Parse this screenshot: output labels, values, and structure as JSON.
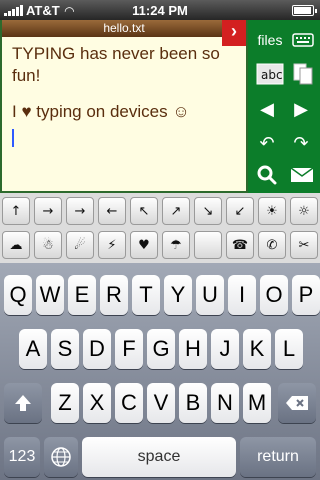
{
  "status_bar": {
    "carrier": "AT&T",
    "time": "11:24 PM"
  },
  "editor": {
    "filename": "hello.txt",
    "close_label": "›",
    "line1": "TYPING has never been so fun!",
    "line2": "I ♥ typing on  devices ☺"
  },
  "side_panel": {
    "files_label": "files"
  },
  "symbol_rows": [
    [
      "↑",
      "→",
      "→",
      "←",
      "↖",
      "↗",
      "↘",
      "↙",
      "☀",
      "☼"
    ],
    [
      "☁",
      "☃",
      "☄",
      "⚡",
      "♥",
      "☂",
      "",
      "☎",
      "✆",
      "✂"
    ]
  ],
  "keyboard": {
    "row1": [
      "Q",
      "W",
      "E",
      "R",
      "T",
      "Y",
      "U",
      "I",
      "O",
      "P"
    ],
    "row2": [
      "A",
      "S",
      "D",
      "F",
      "G",
      "H",
      "J",
      "K",
      "L"
    ],
    "row3": [
      "Z",
      "X",
      "C",
      "V",
      "B",
      "N",
      "M"
    ],
    "numbers_label": "123",
    "space_label": "space",
    "return_label": "return"
  }
}
